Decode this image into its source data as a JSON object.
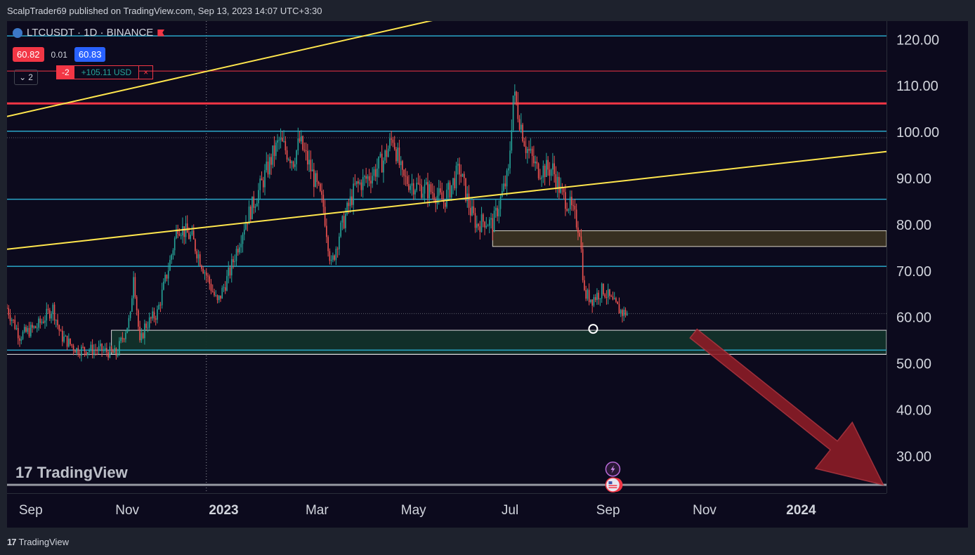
{
  "publish_line": "ScalpTrader69 published on TradingView.com, Sep 13, 2023 14:07 UTC+3:30",
  "header": {
    "symbol_text": "LTCUSDT · 1D · BINANCE"
  },
  "quotes": {
    "bid": "60.82",
    "spread": "0.01",
    "ask": "60.83"
  },
  "position": {
    "qty": "-2",
    "pnl": "+105.11 USD",
    "close": "×"
  },
  "legend_toggle": {
    "count": "2",
    "icon": "chevron-down-icon"
  },
  "watermark": "TradingView",
  "footer": {
    "brand": "TradingView",
    "icon": "tradingview-logo-icon"
  },
  "colors": {
    "background": "#0c0a1d",
    "up": "#26a69a",
    "down": "#ef5350",
    "cyan_level": "#2aa6c8",
    "red_level": "#f23645",
    "trendline": "#ffe64d",
    "arrow": "#8c1c26"
  },
  "chart_data": {
    "type": "candlestick",
    "symbol": "LTCUSDT",
    "timeframe": "1D",
    "exchange": "BINANCE",
    "y_axis": {
      "min": 22,
      "max": 124,
      "ticks": [
        "120.00",
        "110.00",
        "100.00",
        "90.00",
        "80.00",
        "70.00",
        "60.00",
        "50.00",
        "40.00",
        "30.00"
      ],
      "tick_values": [
        120,
        110,
        100,
        90,
        80,
        70,
        60,
        50,
        40,
        30
      ]
    },
    "x_axis": {
      "start": "2022-08-17",
      "end": "2024-02-24",
      "labels": [
        {
          "date": "2022-09-01",
          "text": "Sep",
          "bold": false
        },
        {
          "date": "2022-11-01",
          "text": "Nov",
          "bold": false
        },
        {
          "date": "2023-01-01",
          "text": "2023",
          "bold": true
        },
        {
          "date": "2023-03-01",
          "text": "Mar",
          "bold": false
        },
        {
          "date": "2023-05-01",
          "text": "May",
          "bold": false
        },
        {
          "date": "2023-07-01",
          "text": "Jul",
          "bold": false
        },
        {
          "date": "2023-09-01",
          "text": "Sep",
          "bold": false
        },
        {
          "date": "2023-11-01",
          "text": "Nov",
          "bold": false
        },
        {
          "date": "2024-01-01",
          "text": "2024",
          "bold": true
        }
      ]
    },
    "price_anchors": [
      [
        "2022-08-17",
        62
      ],
      [
        "2022-08-25",
        56
      ],
      [
        "2022-09-05",
        58
      ],
      [
        "2022-09-15",
        62
      ],
      [
        "2022-09-20",
        56
      ],
      [
        "2022-09-30",
        53
      ],
      [
        "2022-10-15",
        53
      ],
      [
        "2022-10-25",
        52
      ],
      [
        "2022-11-03",
        60
      ],
      [
        "2022-11-05",
        70
      ],
      [
        "2022-11-09",
        54
      ],
      [
        "2022-11-12",
        58
      ],
      [
        "2022-11-20",
        61
      ],
      [
        "2022-11-28",
        72
      ],
      [
        "2022-12-03",
        80
      ],
      [
        "2022-12-12",
        77
      ],
      [
        "2022-12-20",
        70
      ],
      [
        "2022-12-28",
        63
      ],
      [
        "2023-01-05",
        70
      ],
      [
        "2023-01-14",
        80
      ],
      [
        "2023-01-24",
        88
      ],
      [
        "2023-02-01",
        95
      ],
      [
        "2023-02-05",
        98
      ],
      [
        "2023-02-14",
        94
      ],
      [
        "2023-02-18",
        98
      ],
      [
        "2023-02-25",
        92
      ],
      [
        "2023-03-05",
        84
      ],
      [
        "2023-03-10",
        71
      ],
      [
        "2023-03-15",
        78
      ],
      [
        "2023-03-25",
        88
      ],
      [
        "2023-04-05",
        91
      ],
      [
        "2023-04-12",
        94
      ],
      [
        "2023-04-18",
        99
      ],
      [
        "2023-04-24",
        90
      ],
      [
        "2023-05-05",
        88
      ],
      [
        "2023-05-14",
        87
      ],
      [
        "2023-05-20",
        85
      ],
      [
        "2023-05-30",
        92
      ],
      [
        "2023-06-06",
        83
      ],
      [
        "2023-06-10",
        80
      ],
      [
        "2023-06-15",
        81
      ],
      [
        "2023-06-20",
        80
      ],
      [
        "2023-06-30",
        91
      ],
      [
        "2023-07-03",
        108
      ],
      [
        "2023-07-05",
        106
      ],
      [
        "2023-07-11",
        97
      ],
      [
        "2023-07-18",
        92
      ],
      [
        "2023-07-28",
        92
      ],
      [
        "2023-08-02",
        87
      ],
      [
        "2023-08-08",
        84
      ],
      [
        "2023-08-14",
        79
      ],
      [
        "2023-08-17",
        65
      ],
      [
        "2023-08-22",
        64
      ],
      [
        "2023-08-29",
        66
      ],
      [
        "2023-09-04",
        63
      ],
      [
        "2023-09-10",
        61
      ],
      [
        "2023-09-13",
        61
      ]
    ],
    "horizontal_levels": [
      {
        "price": 120.8,
        "color": "cyan_level",
        "width": 1.5
      },
      {
        "price": 113.2,
        "color": "red_level",
        "width": 1
      },
      {
        "price": 106.2,
        "color": "red_level",
        "width": 3
      },
      {
        "price": 100.2,
        "color": "cyan_level",
        "width": 1.5
      },
      {
        "price": 98.8,
        "color": "dotted",
        "width": 1
      },
      {
        "price": 85.5,
        "color": "cyan_level",
        "width": 1.5
      },
      {
        "price": 71.0,
        "color": "cyan_level",
        "width": 1.5
      },
      {
        "price": 60.8,
        "color": "dotted",
        "width": 1
      },
      {
        "price": 52.9,
        "color": "cyan_level",
        "width": 1.5
      },
      {
        "price": 52.0,
        "color": "white",
        "width": 1
      },
      {
        "price": 23.8,
        "color": "gray",
        "width": 3
      }
    ],
    "zones": [
      {
        "from": "2023-06-20",
        "to": "2024-02-24",
        "top": 78.7,
        "bottom": 75.3,
        "fill": "#3a3222",
        "border": "#e6e0d0"
      },
      {
        "from": "2022-10-22",
        "to": "2024-02-24",
        "top": 57.2,
        "bottom": 52.0,
        "fill": "#12312a",
        "border": "#e6e6e6"
      }
    ],
    "trendlines": [
      {
        "from": [
          "2022-08-17",
          103.4
        ],
        "to": [
          "2023-05-15",
          124.3
        ]
      },
      {
        "from": [
          "2022-08-17",
          74.7
        ],
        "to": [
          "2024-02-24",
          95.8
        ]
      }
    ],
    "vertical_marker": "2022-12-21",
    "arrow": {
      "from": [
        "2023-10-25",
        56.5
      ],
      "to": [
        "2024-02-22",
        23.8
      ]
    },
    "event_markers": [
      {
        "date": "2023-09-04",
        "price": 27.2,
        "icon": "lightning-icon"
      },
      {
        "date": "2023-09-04",
        "price": 23.8,
        "icon": "us-flag-icon"
      }
    ],
    "cursor_marker": {
      "date": "2023-08-19",
      "price": 57.5
    }
  }
}
